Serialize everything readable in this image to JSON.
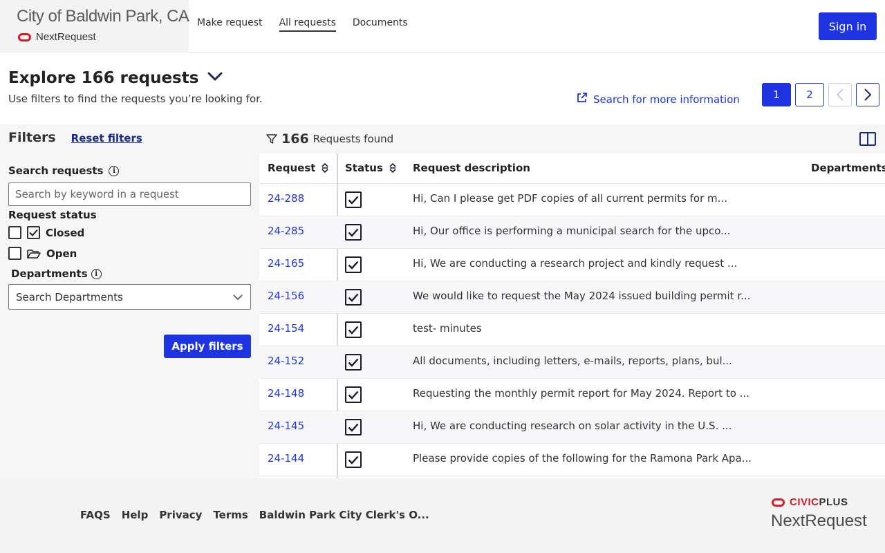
{
  "header": {
    "city": "City of Baldwin Park, CA",
    "product": "NextRequest",
    "nav": [
      {
        "label": "Make request",
        "active": false
      },
      {
        "label": "All requests",
        "active": true
      },
      {
        "label": "Documents",
        "active": false
      }
    ],
    "sign_in": "Sign in"
  },
  "intro": {
    "title": "Explore 166 requests",
    "subtitle": "Use filters to find the requests you’re looking for.",
    "more_info": "Search for more information"
  },
  "pagination": {
    "pages": [
      "1",
      "2"
    ],
    "current": "1"
  },
  "filters": {
    "title": "Filters",
    "reset": "Reset filters",
    "search_label": "Search requests",
    "search_placeholder": "Search by keyword in a request",
    "search_value": "",
    "status_label": "Request status",
    "status_options": [
      {
        "label": "Closed",
        "checked": false,
        "icon": "checked-box-icon"
      },
      {
        "label": "Open",
        "checked": false,
        "icon": "folder-open-icon"
      }
    ],
    "departments_label": "Departments",
    "departments_placeholder": "Search Departments",
    "apply": "Apply filters"
  },
  "results": {
    "count": "166",
    "count_label": "Requests found",
    "columns": {
      "request": "Request",
      "status": "Status",
      "description": "Request description",
      "departments": "Departments"
    },
    "rows": [
      {
        "id": "24-288",
        "status": "closed",
        "description": "Hi, Can I please get PDF copies of all current permits for m..."
      },
      {
        "id": "24-285",
        "status": "closed",
        "description": "Hi, Our office is performing a municipal search for the upco..."
      },
      {
        "id": "24-165",
        "status": "closed",
        "description": "Hi, We are conducting a research project and kindly request ..."
      },
      {
        "id": "24-156",
        "status": "closed",
        "description": "We would like to request the May 2024 issued building permit r..."
      },
      {
        "id": "24-154",
        "status": "closed",
        "description": "test- minutes"
      },
      {
        "id": "24-152",
        "status": "closed",
        "description": "All documents, including letters, e-mails, reports, plans, bul..."
      },
      {
        "id": "24-148",
        "status": "closed",
        "description": "Requesting the monthly permit report for May 2024. Report to ..."
      },
      {
        "id": "24-145",
        "status": "closed",
        "description": "Hi, We are conducting research on solar activity in the U.S. ..."
      },
      {
        "id": "24-144",
        "status": "closed",
        "description": "Please provide copies of the following for the Ramona Park Apa..."
      }
    ]
  },
  "footer": {
    "links": [
      "FAQS",
      "Help",
      "Privacy",
      "Terms",
      "Baldwin Park City Clerk's O..."
    ],
    "civic_brand": "CIVIC",
    "civic_brand_bold": "PLUS",
    "nextrequest": "NextRequest"
  },
  "colors": {
    "accent": "#1d34e0",
    "brand_red": "#d01d2a"
  }
}
